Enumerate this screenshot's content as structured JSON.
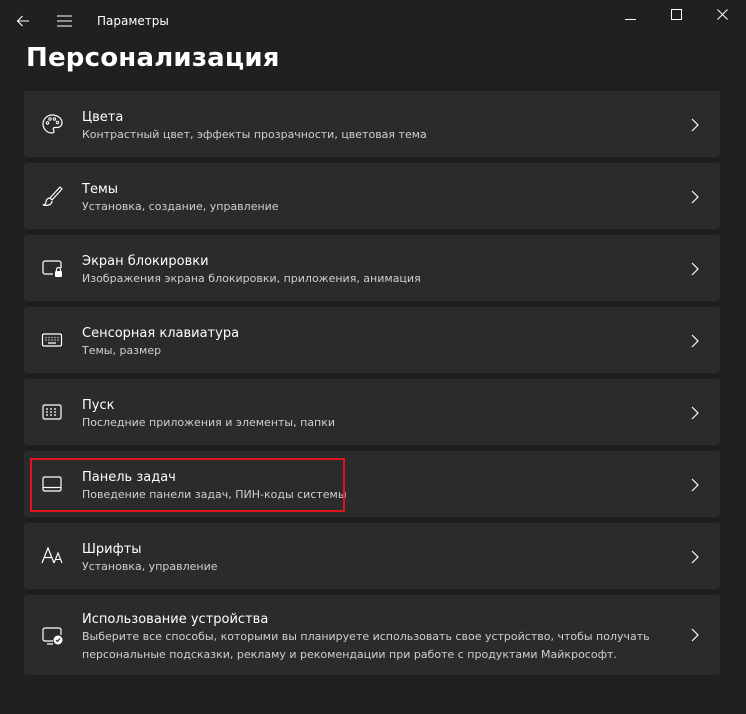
{
  "window": {
    "app_title": "Параметры",
    "icons": {
      "back": "back-arrow-icon",
      "menu": "hamburger-menu-icon",
      "minimize": "minimize-icon",
      "maximize": "maximize-icon",
      "close": "close-icon"
    }
  },
  "page": {
    "title": "Персонализация"
  },
  "items": [
    {
      "title": "Цвета",
      "desc": "Контрастный цвет, эффекты прозрачности, цветовая тема",
      "icon": "palette-icon"
    },
    {
      "title": "Темы",
      "desc": "Установка, создание, управление",
      "icon": "brush-icon"
    },
    {
      "title": "Экран блокировки",
      "desc": "Изображения экрана блокировки, приложения, анимация",
      "icon": "lock-screen-icon"
    },
    {
      "title": "Сенсорная клавиатура",
      "desc": "Темы, размер",
      "icon": "keyboard-icon"
    },
    {
      "title": "Пуск",
      "desc": "Последние приложения и элементы, папки",
      "icon": "start-menu-icon"
    },
    {
      "title": "Панель задач",
      "desc": "Поведение панели задач, ПИН-коды системы",
      "icon": "taskbar-icon"
    },
    {
      "title": "Шрифты",
      "desc": "Установка, управление",
      "icon": "fonts-icon"
    },
    {
      "title": "Использование устройства",
      "desc": "Выберите все способы, которыми вы планируете использовать свое устройство, чтобы получать персональные подсказки, рекламу и рекомендации при работе с продуктами Майкрософт.",
      "icon": "device-usage-icon"
    }
  ],
  "highlight": {
    "target": "Панель задач",
    "color": "#e0141e"
  },
  "colors": {
    "background": "#202020",
    "card": "#2b2b2b",
    "text": "#ffffff",
    "secondary_text": "#cfcfcf"
  }
}
